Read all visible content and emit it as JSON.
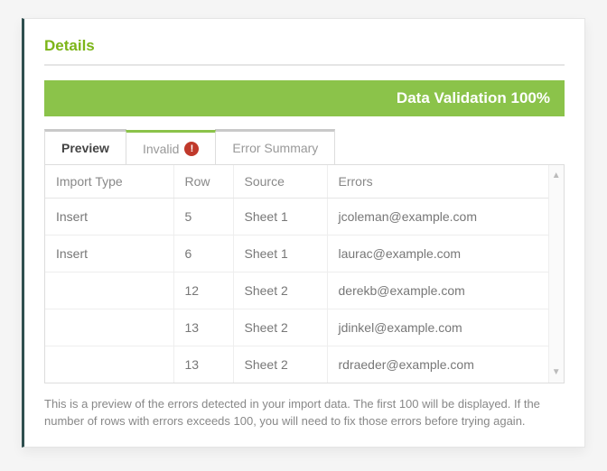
{
  "section_title": "Details",
  "status_bar": "Data Validation 100%",
  "tabs": [
    {
      "label": "Preview"
    },
    {
      "label": "Invalid"
    },
    {
      "label": "Error Summary"
    }
  ],
  "columns": {
    "import_type": "Import Type",
    "row": "Row",
    "source": "Source",
    "errors": "Errors"
  },
  "rows": [
    {
      "import_type": "Insert",
      "row": "5",
      "source": "Sheet 1",
      "errors": "jcoleman@example.com"
    },
    {
      "import_type": "Insert",
      "row": "6",
      "source": "Sheet 1",
      "errors": "laurac@example.com"
    },
    {
      "import_type": "",
      "row": "12",
      "source": "Sheet 2",
      "errors": "derekb@example.com"
    },
    {
      "import_type": "",
      "row": "13",
      "source": "Sheet 2",
      "errors": "jdinkel@example.com"
    },
    {
      "import_type": "",
      "row": "13",
      "source": "Sheet 2",
      "errors": "rdraeder@example.com"
    }
  ],
  "footer_note": "This is a preview of the errors detected in your import data. The first 100 will be displayed. If the number of rows with errors exceeds 100, you will need to fix those errors before trying again."
}
